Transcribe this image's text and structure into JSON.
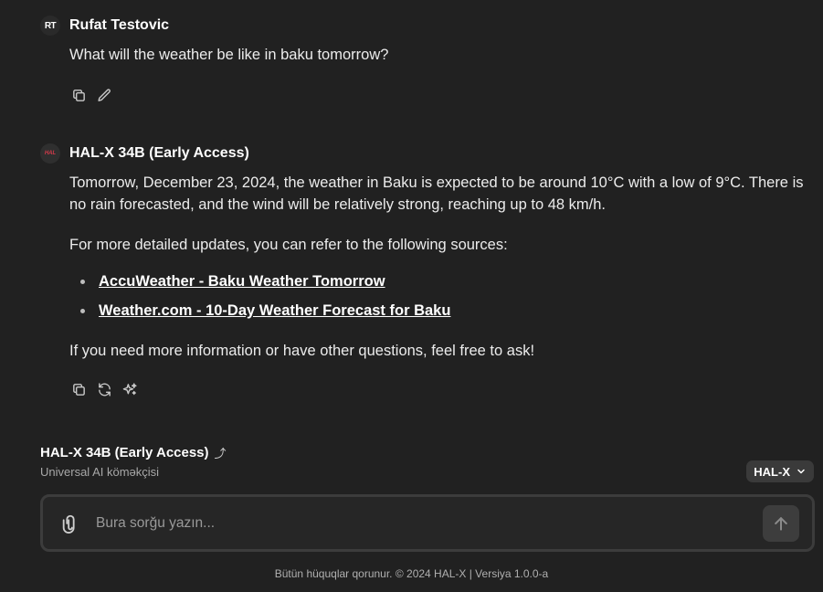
{
  "user_message": {
    "avatar_initials": "RT",
    "author": "Rufat Testovic",
    "text": "What will the weather be like in baku tomorrow?",
    "actions": [
      "copy-icon",
      "edit-icon"
    ]
  },
  "ai_message": {
    "avatar_text": "HAL",
    "author": "HAL-X 34B (Early Access)",
    "paragraph_1": "Tomorrow, December 23, 2024, the weather in Baku is expected to be around 10°C with a low of 9°C. There is no rain forecasted, and the wind will be relatively strong, reaching up to 48 km/h.",
    "paragraph_2": "For more detailed updates, you can refer to the following sources:",
    "links": [
      {
        "label": "AccuWeather - Baku Weather Tomorrow"
      },
      {
        "label": "Weather.com - 10-Day Weather Forecast for Baku"
      }
    ],
    "paragraph_3": "If you need more information or have other questions, feel free to ask!",
    "actions": [
      "copy-icon",
      "regenerate-icon",
      "sparkle-icon"
    ]
  },
  "model_bar": {
    "title": "HAL-X 34B (Early Access)",
    "title_icon": "external-arrow-icon",
    "subtitle": "Universal AI köməkçisi",
    "selected_model": "HAL-X"
  },
  "composer": {
    "placeholder": "Bura sorğu yazın...",
    "value": ""
  },
  "footer": {
    "text": "Bütün hüquqlar qorunur. © 2024 HAL-X | Versiya 1.0.0-a"
  },
  "colors": {
    "background": "#212121",
    "composer_border": "#3c3c3c",
    "hal_accent": "#d43a4a"
  }
}
